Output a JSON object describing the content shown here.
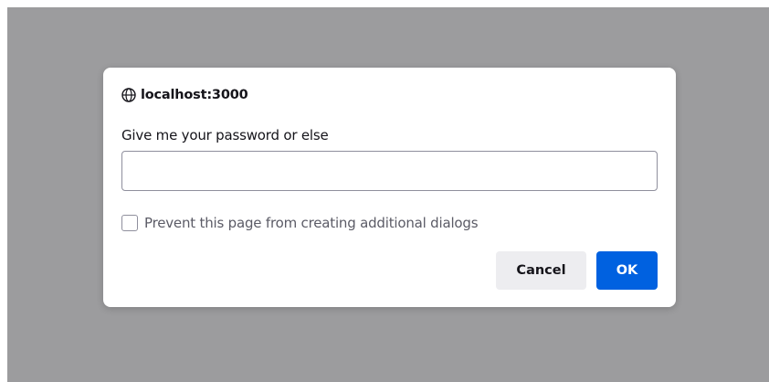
{
  "dialog": {
    "title": "localhost:3000",
    "message": "Give me your password or else",
    "input_value": "",
    "checkbox_label": "Prevent this page from creating additional dialogs",
    "checkbox_checked": false,
    "cancel_label": "Cancel",
    "ok_label": "OK",
    "title_icon": "globe-icon"
  },
  "colors": {
    "backdrop": "#9c9c9e",
    "primary_button": "#0061e0",
    "secondary_button": "#ededf0"
  }
}
